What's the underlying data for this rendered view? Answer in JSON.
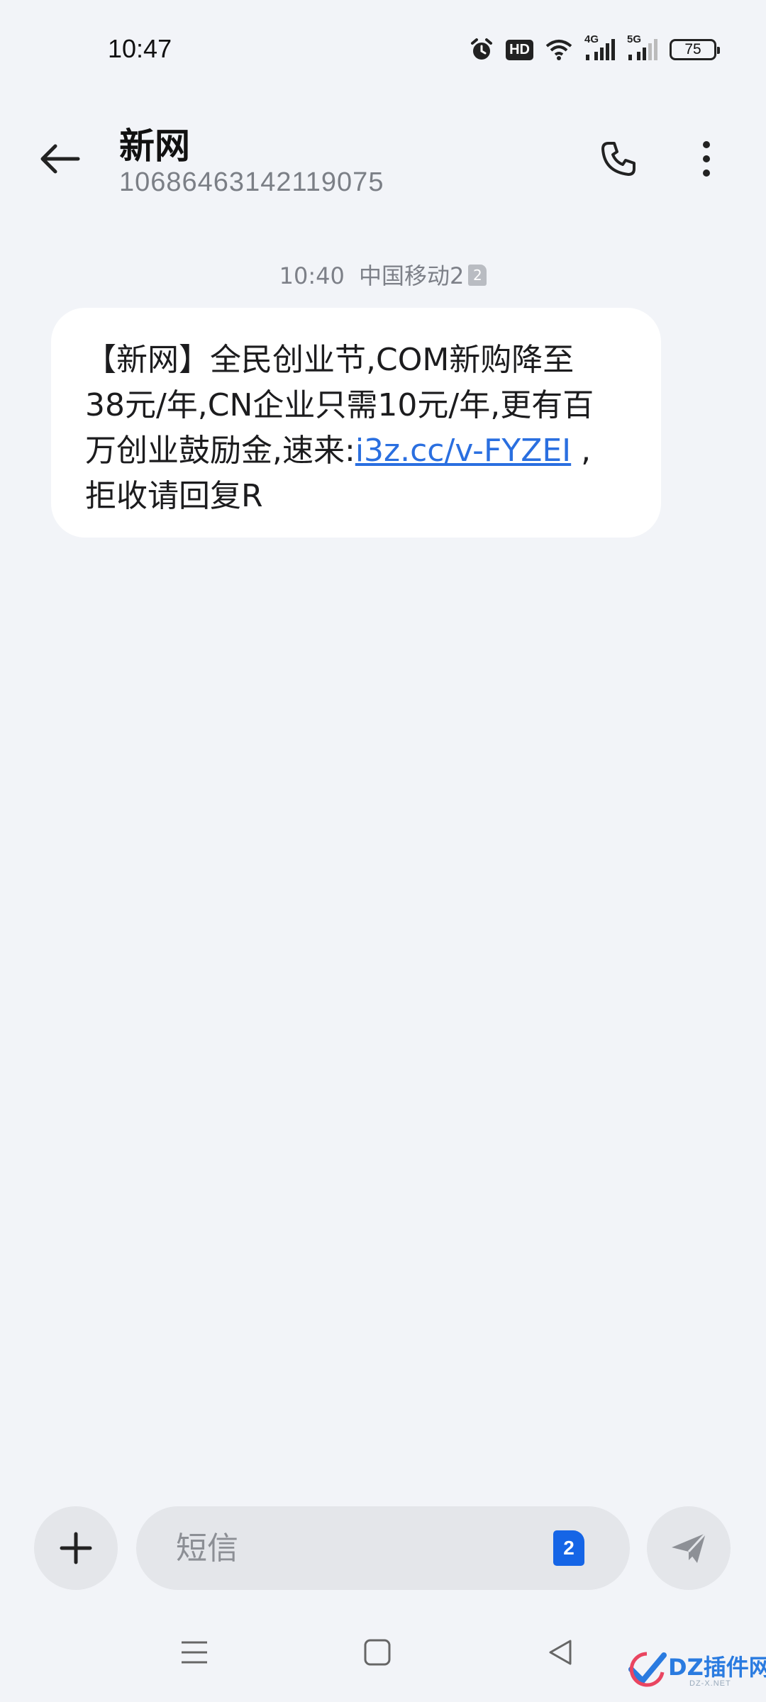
{
  "status_bar": {
    "time": "10:47",
    "hd_label": "HD",
    "net_a": "4G",
    "net_b": "5G",
    "battery": "75"
  },
  "header": {
    "contact_name": "新网",
    "contact_number": "10686463142119075"
  },
  "message": {
    "time": "10:40",
    "carrier": "中国移动2",
    "sim_badge": "2",
    "line1": "【新网】全民创业节,COM新购降至",
    "line2": "38元/年,CN企业只需10元/年,更有百",
    "line3_prefix": "万创业鼓励金,速来:",
    "link": "i3z.cc/v-FYZEI",
    "line3_suffix": " ,",
    "line4": "拒收请回复R"
  },
  "composer": {
    "placeholder": "短信",
    "sim_selector": "2"
  },
  "watermark": {
    "text": "DZ插件网",
    "sub": "DZ-X.NET"
  },
  "colors": {
    "background": "#f2f4f8",
    "bubble": "#ffffff",
    "link": "#2a6fe0",
    "sim_blue": "#1565e6"
  }
}
